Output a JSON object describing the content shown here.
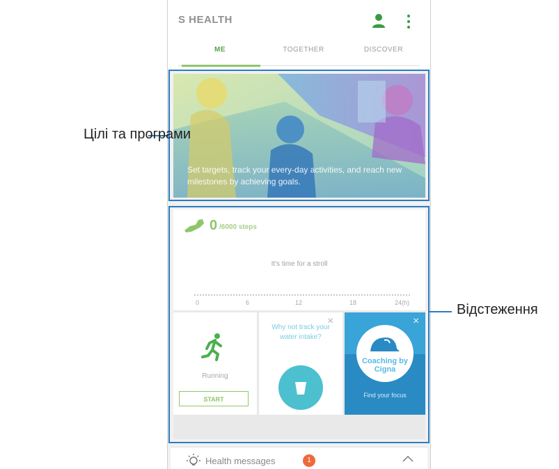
{
  "app": {
    "title": "S HEALTH"
  },
  "header": {
    "profile_icon": "person-icon",
    "more_icon": "more-vertical-icon"
  },
  "tabs": [
    {
      "label": "ME",
      "active": true
    },
    {
      "label": "TOGETHER",
      "active": false
    },
    {
      "label": "DISCOVER",
      "active": false
    }
  ],
  "banner": {
    "caption": "Set targets, track your every-day activities, and reach new milestones by achieving goals."
  },
  "steps": {
    "value": "0",
    "label": "/6000 steps",
    "message": "It's time for a stroll",
    "axis_ticks": [
      "0",
      "6",
      "12",
      "18",
      "24(h)"
    ]
  },
  "tiles": {
    "running": {
      "label": "Running",
      "button": "START"
    },
    "water": {
      "text": "Why not track your water intake?",
      "close": "×"
    },
    "cigna": {
      "brand": "Coaching by Cigna",
      "subtitle": "Find your focus",
      "close": "×"
    }
  },
  "messages": {
    "label": "Health messages",
    "badge": "1"
  },
  "annotations": {
    "goals": "Цілі та програми",
    "tracking": "Відстеження"
  },
  "colors": {
    "accent_green": "#8fc56b",
    "water_teal": "#4cc0cf",
    "cigna_blue": "#2a8ac4",
    "annotation_blue": "#2a7cc1",
    "badge_orange": "#ee6a3a"
  }
}
